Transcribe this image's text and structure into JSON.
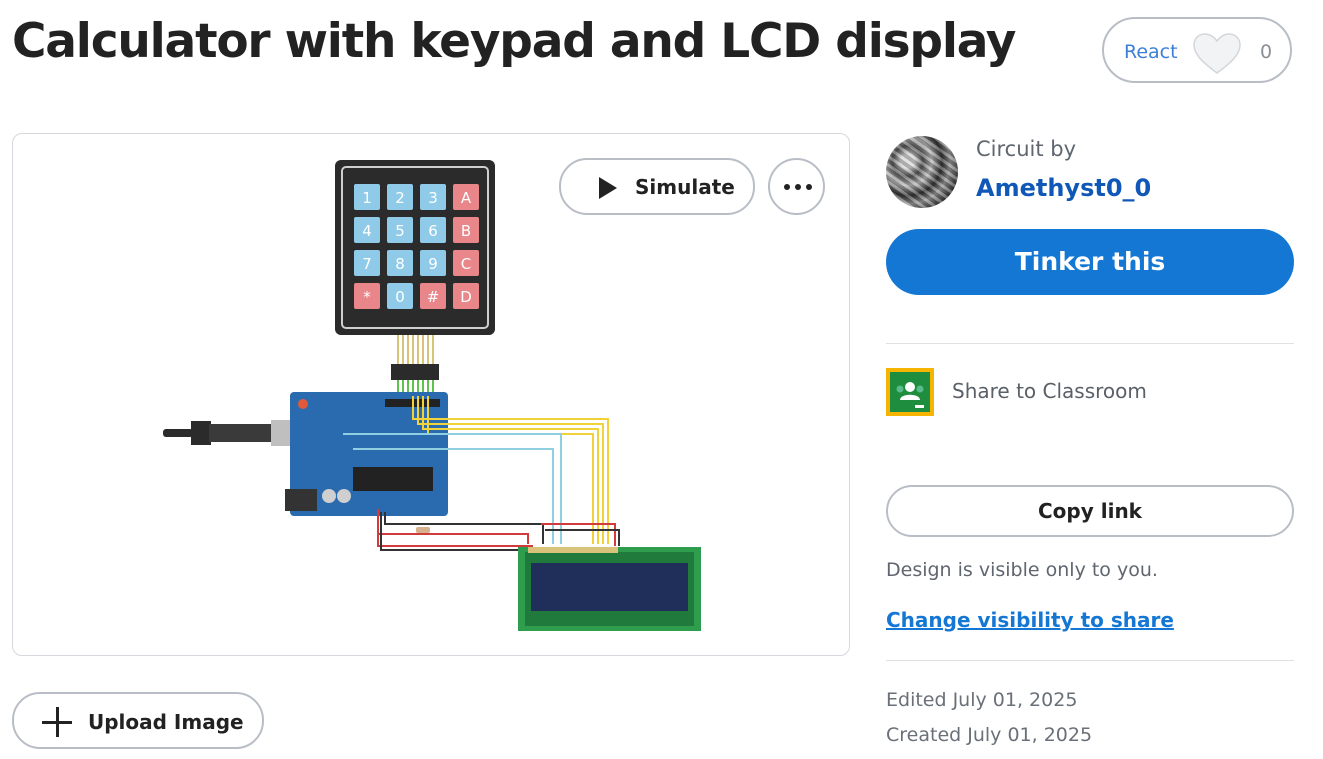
{
  "page": {
    "title": "Calculator with keypad and LCD display"
  },
  "react": {
    "label": "React",
    "count": "0",
    "icon": "heart-icon"
  },
  "preview": {
    "simulate_label": "Simulate",
    "keypad_keys": [
      "1",
      "2",
      "3",
      "A",
      "4",
      "5",
      "6",
      "B",
      "7",
      "8",
      "9",
      "C",
      "*",
      "0",
      "#",
      "D"
    ]
  },
  "upload": {
    "label": "Upload Image"
  },
  "author": {
    "prefix": "Circuit by",
    "name": "Amethyst0_0"
  },
  "actions": {
    "tinker_label": "Tinker this",
    "share_label": "Share to Classroom",
    "copy_label": "Copy link",
    "visibility_note": "Design is visible only to you.",
    "change_visibility_label": "Change visibility to share"
  },
  "meta": {
    "edited": "Edited July 01, 2025",
    "created": "Created July 01, 2025"
  },
  "colors": {
    "accent": "#1477d4",
    "link": "#1058b8",
    "border": "#b9bec6"
  }
}
